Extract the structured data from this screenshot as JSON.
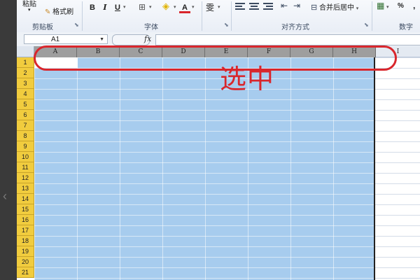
{
  "ribbon": {
    "paste_label": "粘贴",
    "format_painter_label": "格式刷",
    "clipboard_group": "剪贴板",
    "font_group": "字体",
    "alignment_group": "对齐方式",
    "number_group": "数字",
    "bold": "B",
    "italic": "I",
    "underline": "U",
    "font_color": "A",
    "wen": "雯",
    "merge_center_label": "合并后居中",
    "percent": "%",
    "comma": ","
  },
  "formula_bar": {
    "name_box": "A1",
    "fx": "fx",
    "content": ""
  },
  "sheet": {
    "columns": [
      "A",
      "B",
      "C",
      "D",
      "E",
      "F",
      "G",
      "H",
      "I"
    ],
    "selected_columns": [
      "A",
      "B",
      "C",
      "D",
      "E",
      "F",
      "G",
      "H"
    ],
    "rows": [
      "1",
      "2",
      "3",
      "4",
      "5",
      "6",
      "7",
      "8",
      "9",
      "10",
      "11",
      "12",
      "13",
      "14",
      "15",
      "16",
      "17",
      "18",
      "19",
      "20",
      "21"
    ]
  },
  "annotation": {
    "text": "选中",
    "color": "#d9262c"
  },
  "colors": {
    "selection": "#a7ccee",
    "row_header_selected": "#f1cc3e",
    "column_header_selected": "#9e9e9e"
  }
}
